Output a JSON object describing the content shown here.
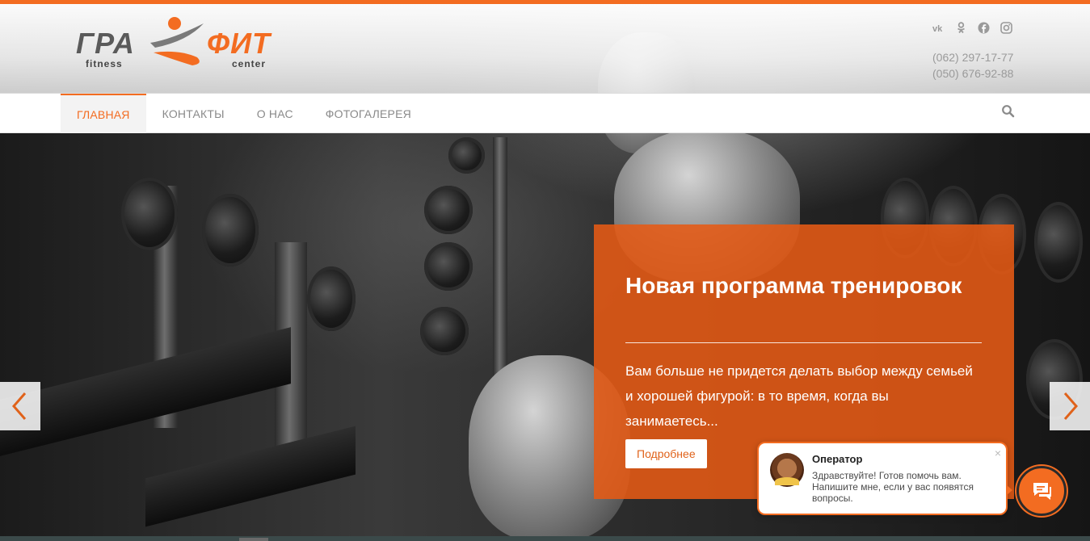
{
  "header": {
    "logo": {
      "left_word": "ГРА",
      "left_sub": "fitness",
      "right_word": "ФИТ",
      "right_sub": "center"
    },
    "social_icons": [
      "vk-icon",
      "odnoklassniki-icon",
      "facebook-icon",
      "instagram-icon"
    ],
    "phones": [
      "(062) 297-17-77",
      "(050) 676-92-88"
    ]
  },
  "nav": {
    "items": [
      {
        "label": "ГЛАВНАЯ",
        "active": true
      },
      {
        "label": "КОНТАКТЫ",
        "active": false
      },
      {
        "label": "О НАС",
        "active": false
      },
      {
        "label": "ФОТОГАЛЕРЕЯ",
        "active": false
      }
    ],
    "search_icon": "search-icon"
  },
  "slide": {
    "title": "Новая программа тренировок",
    "text": "Вам больше не придется делать выбор между семьей и хорошей фигурой: в то время, когда вы занимаетесь...",
    "button_label": "Подробнее",
    "prev_icon": "chevron-left-icon",
    "next_icon": "chevron-right-icon"
  },
  "chat": {
    "operator_name": "Оператор",
    "message": "Здравствуйте! Готов помочь вам. Напишите мне, если у вас появятся вопросы.",
    "close_symbol": "×"
  },
  "colors": {
    "accent": "#f36c21",
    "caption_bg": "#e65a14",
    "nav_text": "#8a8a8a",
    "phone_text": "#9a9a9a"
  }
}
